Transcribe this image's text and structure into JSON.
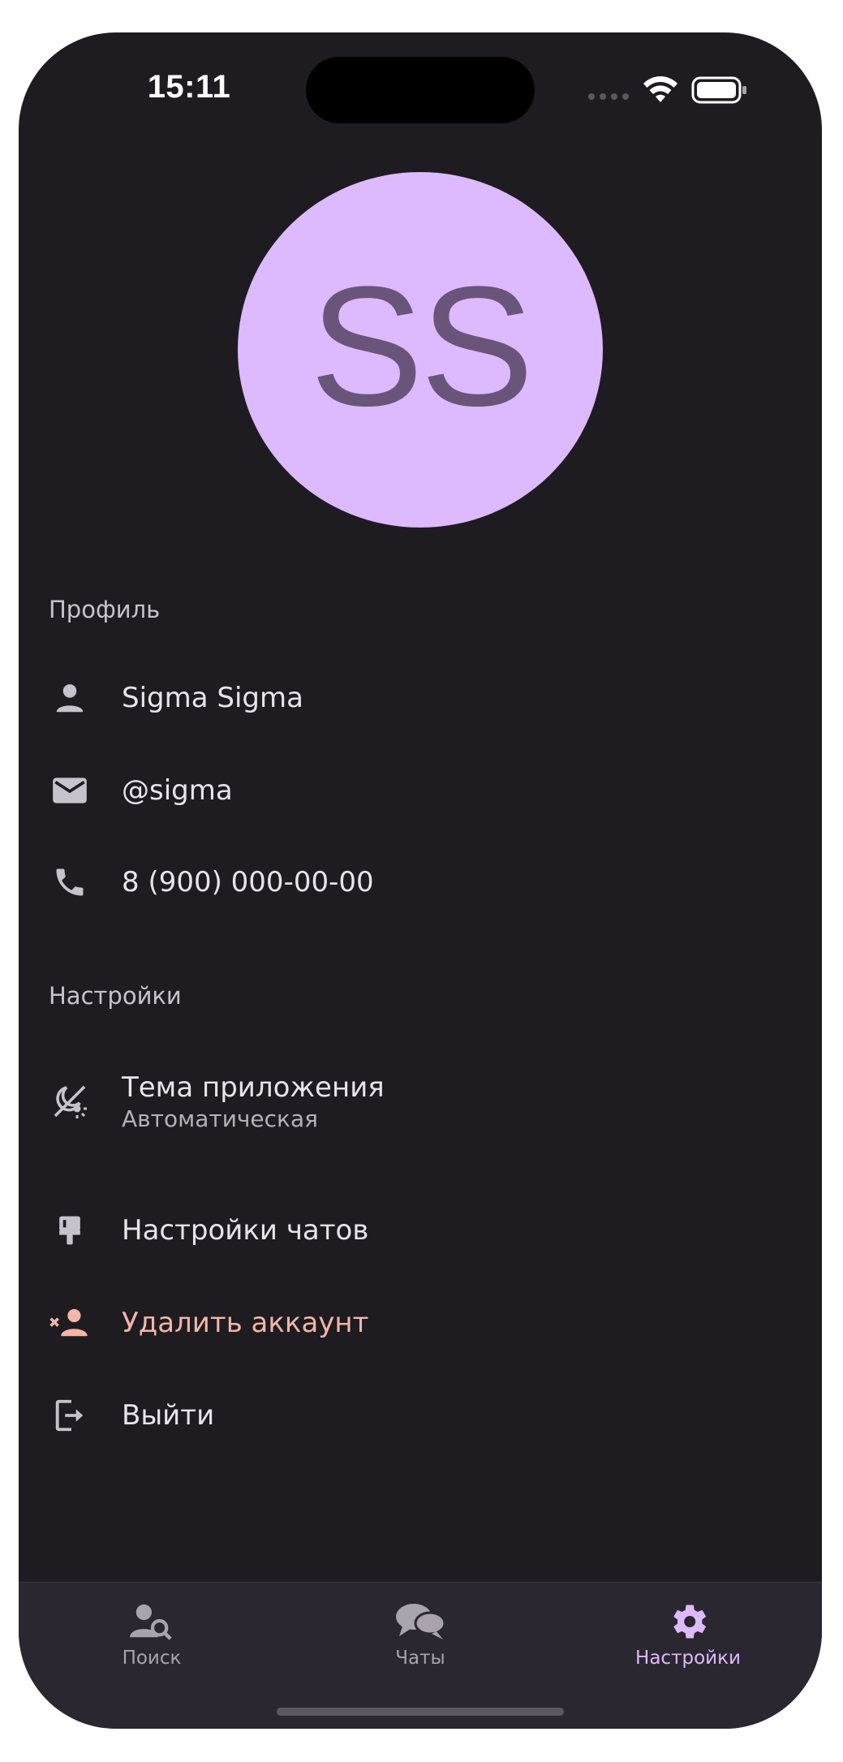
{
  "status_bar": {
    "time": "15:11"
  },
  "avatar": {
    "initials": "SS",
    "background": "#ddb9fd",
    "text_color": "#6b5479"
  },
  "profile_section": {
    "title": "Профиль",
    "items": [
      {
        "icon": "person-icon",
        "label": "Sigma Sigma"
      },
      {
        "icon": "mail-icon",
        "label": "@sigma"
      },
      {
        "icon": "phone-icon",
        "label": "8 (900) 000-00-00"
      }
    ]
  },
  "settings_section": {
    "title": "Настройки",
    "theme": {
      "icon": "theme-icon",
      "label": "Тема приложения",
      "value": "Автоматическая"
    },
    "chat_settings": {
      "icon": "brush-icon",
      "label": "Настройки чатов"
    },
    "delete_account": {
      "icon": "remove-user-icon",
      "label": "Удалить аккаунт",
      "color": "#f2b6a9"
    },
    "logout": {
      "icon": "logout-icon",
      "label": "Выйти"
    }
  },
  "tab_bar": {
    "tabs": [
      {
        "icon": "search-person-icon",
        "label": "Поиск",
        "active": false
      },
      {
        "icon": "chats-icon",
        "label": "Чаты",
        "active": false
      },
      {
        "icon": "gear-icon",
        "label": "Настройки",
        "active": true
      }
    ],
    "accent": "#ddb9fd"
  }
}
